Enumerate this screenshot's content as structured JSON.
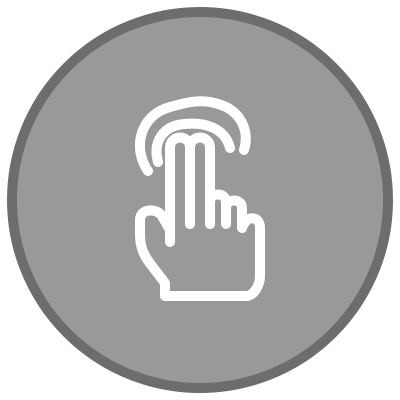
{
  "button": {
    "icon": "two-finger-tap-icon",
    "fill_color": "#999999",
    "ring_color": "#6d6d6d",
    "icon_color": "#ffffff"
  }
}
